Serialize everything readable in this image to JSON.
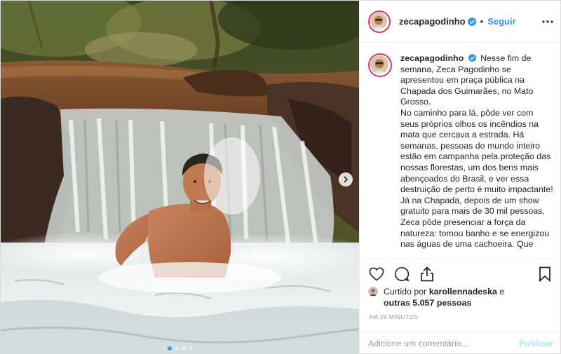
{
  "post": {
    "username": "zecapagodinho",
    "follow_label": "Seguir",
    "caption_paragraphs": [
      "Nesse fim de semana, Zeca Pagodinho se apresentou em praça pública na Chapada dos Guimarães, no Mato Grosso.",
      "No caminho para lá, pôde ver com seus próprios olhos os incêndios na mata que cercava a estrada. Há semanas, pessoas do mundo inteiro estão em campanha pela proteção das nossas florestas, um dos bens mais abençoados do Brasil, e ver essa destruição de perto é muito impactante!",
      "Já na Chapada, depois de um show gratuito para mais de 30 mil pessoas, Zeca pôde presenciar a força da natureza: tomou banho e se energizou nas águas de uma cachoeira. Que"
    ],
    "likes": {
      "prefix": "Curtido por",
      "liker": "karollennadeska",
      "connector": "e",
      "others": "outras 5.057 pessoas"
    },
    "timestamp": "HÁ 26 MINUTOS",
    "comment_placeholder": "Adicione um comentário...",
    "publish_label": "Publicar"
  },
  "icons": {
    "verified": "verified-badge-icon",
    "more": "more-options-icon",
    "like": "heart-icon",
    "comment": "comment-icon",
    "share": "share-icon",
    "save": "bookmark-icon",
    "next": "chevron-right-icon"
  },
  "carousel": {
    "total": 4,
    "current": 1
  },
  "colors": {
    "link_blue": "#3897f0",
    "publish_disabled": "#b2dffc",
    "story_ring": "#e1306c",
    "muted": "#999999"
  }
}
